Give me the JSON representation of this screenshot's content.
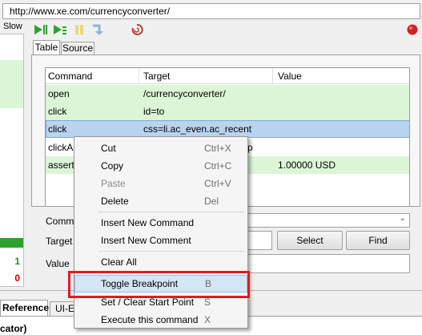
{
  "url": "http://www.xe.com/currencyconverter/",
  "speed_label": "Slow",
  "left_panel": {
    "runs": "1",
    "failures": "0"
  },
  "toolbar": {
    "buttons": [
      "play-all-icon",
      "play-current-icon",
      "pause-icon",
      "step-icon",
      "rollup-icon",
      "record-icon"
    ]
  },
  "tabs": {
    "table": "Table",
    "source": "Source"
  },
  "table": {
    "headers": {
      "command": "Command",
      "target": "Target",
      "value": "Value"
    },
    "rows": [
      {
        "command": "open",
        "target": "/currencyconverter/",
        "value": "",
        "state": "pass"
      },
      {
        "command": "click",
        "target": "id=to",
        "value": "",
        "state": "pass"
      },
      {
        "command": "click",
        "target": "css=li.ac_even.ac_recent",
        "value": "",
        "state": "selected"
      },
      {
        "command": "clickA",
        "target": "p",
        "value": "",
        "state": "none"
      },
      {
        "command": "assertT",
        "target": "",
        "value": "1.00000 USD",
        "state": "pass"
      }
    ]
  },
  "editor": {
    "command_label": "Comm",
    "target_label": "Target",
    "value_label": "Value",
    "select_button": "Select",
    "find_button": "Find"
  },
  "bottom": {
    "tab_reference": "Reference",
    "tab_uie": "UI-E",
    "content": "cator)"
  },
  "context_menu": {
    "items": [
      {
        "label": "Cut",
        "shortcut": "Ctrl+X",
        "enabled": true
      },
      {
        "label": "Copy",
        "shortcut": "Ctrl+C",
        "enabled": true
      },
      {
        "label": "Paste",
        "shortcut": "Ctrl+V",
        "enabled": false
      },
      {
        "label": "Delete",
        "shortcut": "Del",
        "enabled": true
      },
      {
        "label": "Insert New Command",
        "shortcut": "",
        "enabled": true
      },
      {
        "label": "Insert New Comment",
        "shortcut": "",
        "enabled": true
      },
      {
        "label": "Clear All",
        "shortcut": "",
        "enabled": true
      },
      {
        "label": "Toggle Breakpoint",
        "shortcut": "B",
        "enabled": true,
        "highlighted": true
      },
      {
        "label": "Set / Clear Start Point",
        "shortcut": "S",
        "enabled": true
      },
      {
        "label": "Execute this command",
        "shortcut": "X",
        "enabled": true
      }
    ]
  },
  "colors": {
    "pass_row": "#dcf5d6",
    "selected_row": "#b9d4ef",
    "highlight_box": "#e01b24"
  }
}
